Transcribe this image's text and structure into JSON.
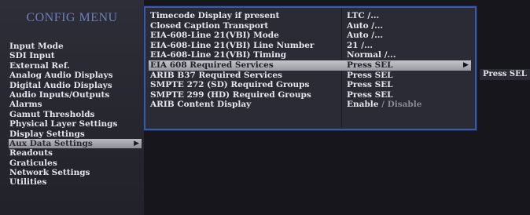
{
  "config_menu": {
    "title": "CONFIG MENU",
    "items": [
      {
        "label": "Input Mode"
      },
      {
        "label": "SDI Input"
      },
      {
        "label": "External Ref."
      },
      {
        "label": "Analog Audio Displays"
      },
      {
        "label": "Digital Audio Displays"
      },
      {
        "label": "Audio Inputs/Outputs"
      },
      {
        "label": "Alarms"
      },
      {
        "label": "Gamut Thresholds"
      },
      {
        "label": "Physical Layer Settings"
      },
      {
        "label": "Display Settings"
      },
      {
        "label": "Aux Data Settings",
        "selected": true,
        "arrow": "▶"
      },
      {
        "label": "Readouts"
      },
      {
        "label": "Graticules"
      },
      {
        "label": "Network Settings"
      },
      {
        "label": "Utilities"
      }
    ]
  },
  "aux_submenu": {
    "rows": [
      {
        "label": "Timecode Display if present",
        "value": "LTC /..."
      },
      {
        "label": "Closed Caption Transport",
        "value": "Auto /..."
      },
      {
        "label": "EIA-608-Line 21(VBI) Mode",
        "value": "Auto /..."
      },
      {
        "label": "EIA-608-Line 21(VBI) Line Number",
        "value": "21  /..."
      },
      {
        "label": "EIA-608-Line 21(VBI) Timing",
        "value": "Normal /..."
      },
      {
        "label": "EIA 608 Required Services",
        "value": "Press SEL",
        "selected": true,
        "arrow": "▶"
      },
      {
        "label": "ARIB B37 Required Services",
        "value": "Press SEL"
      },
      {
        "label": "SMPTE 272 (SD) Required Groups",
        "value": "Press SEL"
      },
      {
        "label": "SMPTE 299 (HD) Required Groups",
        "value": "Press SEL"
      },
      {
        "label": "ARIB Content Display",
        "value": "Enable",
        "value_suffix": " / Disable"
      }
    ]
  },
  "flyout": {
    "label": "Press SEL"
  }
}
